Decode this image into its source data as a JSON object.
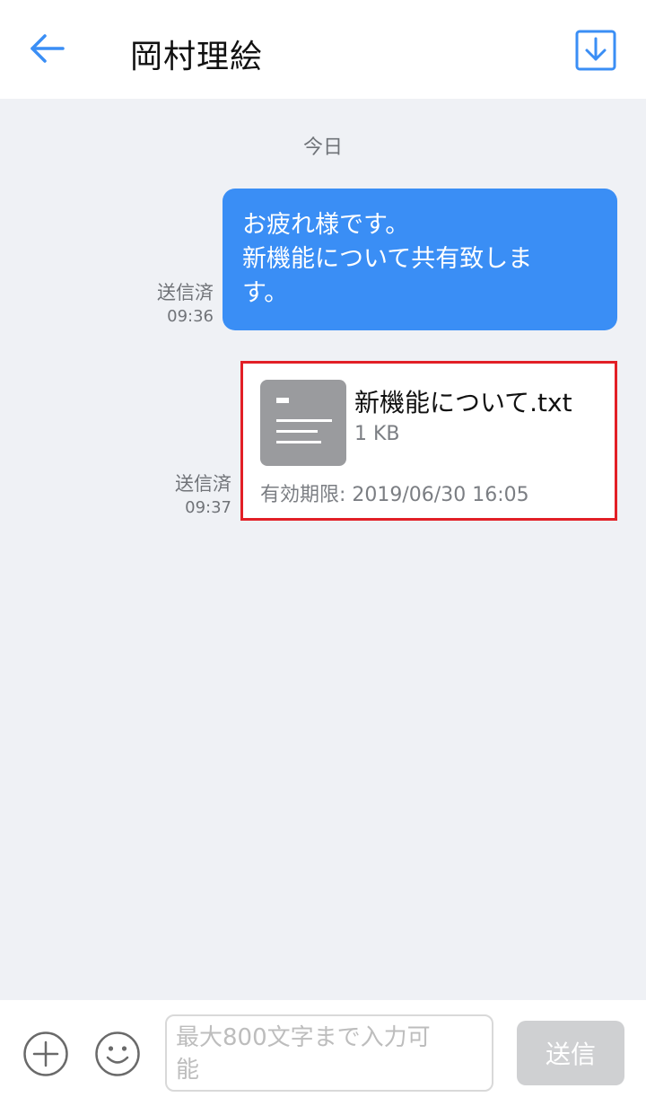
{
  "header": {
    "title": "岡村理絵",
    "back_icon": "arrow-left-icon",
    "download_icon": "download-icon"
  },
  "chat": {
    "date_label": "今日",
    "messages": [
      {
        "lines": [
          "お疲れ様です。",
          "新機能について共有致しま",
          "す。"
        ],
        "status": "送信済",
        "time": "09:36"
      }
    ],
    "file_message": {
      "file_name": "新機能について.txt",
      "file_size": "1 KB",
      "expiry": "有効期限: 2019/06/30 16:05",
      "status": "送信済",
      "time": "09:37"
    }
  },
  "input_bar": {
    "placeholder_lines": [
      "最大800文字まで入力可",
      "能"
    ],
    "send_label": "送信",
    "plus_icon": "plus-circle-icon",
    "emoji_icon": "smiley-icon"
  },
  "colors": {
    "accent": "#3a8ef5",
    "highlight_border": "#e21f26",
    "background": "#eff1f5"
  }
}
